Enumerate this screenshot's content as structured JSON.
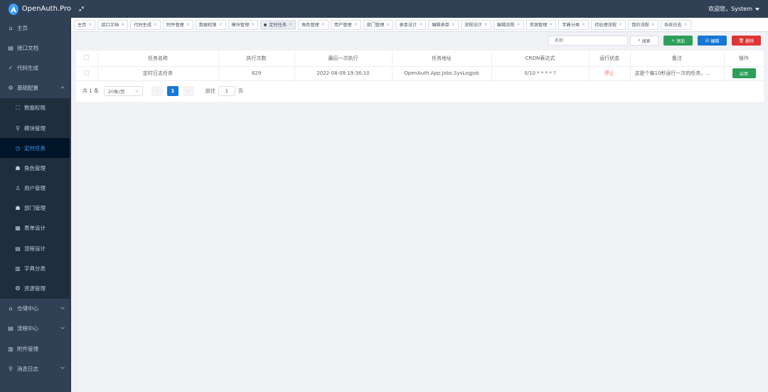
{
  "app": {
    "title": "OpenAuth.Pro"
  },
  "header": {
    "welcome": "欢迎您，System"
  },
  "sidebar": {
    "items": [
      {
        "label": "主页",
        "icon": "home-icon"
      },
      {
        "label": "接口文档",
        "icon": "doc-icon"
      },
      {
        "label": "代码生成",
        "icon": "check-circle-icon"
      },
      {
        "label": "基础配置",
        "icon": "gear-icon",
        "expanded": true
      },
      {
        "label": "数据权限",
        "icon": "data-permission-icon",
        "sub": true
      },
      {
        "label": "模块管理",
        "icon": "tree-icon",
        "sub": true
      },
      {
        "label": "定时任务",
        "icon": "clock-task-icon",
        "sub": true,
        "active": true
      },
      {
        "label": "角色管理",
        "icon": "role-icon",
        "sub": true
      },
      {
        "label": "用户管理",
        "icon": "user-icon",
        "sub": true
      },
      {
        "label": "部门管理",
        "icon": "department-icon",
        "sub": true
      },
      {
        "label": "表单设计",
        "icon": "form-icon",
        "sub": true
      },
      {
        "label": "流程设计",
        "icon": "flow-design-icon",
        "sub": true
      },
      {
        "label": "字典分类",
        "icon": "dictionary-icon",
        "sub": true
      },
      {
        "label": "资源管理",
        "icon": "resource-icon",
        "sub": true
      },
      {
        "label": "仓储中心",
        "icon": "warehouse-icon"
      },
      {
        "label": "流程中心",
        "icon": "flow-center-icon"
      },
      {
        "label": "附件管理",
        "icon": "attachment-icon"
      },
      {
        "label": "消息日志",
        "icon": "message-log-icon"
      }
    ]
  },
  "tabs": [
    {
      "label": "主页"
    },
    {
      "label": "接口文档"
    },
    {
      "label": "代码生成"
    },
    {
      "label": "附件管理"
    },
    {
      "label": "数据权限"
    },
    {
      "label": "模块管理"
    },
    {
      "label": "定时任务",
      "active": true
    },
    {
      "label": "角色管理"
    },
    {
      "label": "用户管理"
    },
    {
      "label": "部门管理"
    },
    {
      "label": "表单设计"
    },
    {
      "label": "编辑表单"
    },
    {
      "label": "流程设计"
    },
    {
      "label": "编辑流程"
    },
    {
      "label": "资源管理"
    },
    {
      "label": "字典分类"
    },
    {
      "label": "待处理流程"
    },
    {
      "label": "我的流程"
    },
    {
      "label": "系统日志"
    }
  ],
  "tab_close": "×",
  "toolbar": {
    "search_placeholder": "名称",
    "search_label": "搜索",
    "add_label": "添加",
    "edit_label": "编辑",
    "delete_label": "删除"
  },
  "table": {
    "columns": [
      "任务名称",
      "执行次数",
      "最后一次执行",
      "任务地址",
      "CRON表达式",
      "运行状态",
      "备注",
      "操作"
    ],
    "rows": [
      {
        "name": "定时日志任务",
        "run_count": "629",
        "last_run": "2022-08-09 19:36:10",
        "address": "OpenAuth.App.Jobs.SysLogJob",
        "cron": "0/10 * * * * ?",
        "status": "停止",
        "note": "这是个每10秒运行一次的任务，...",
        "action": "启用"
      }
    ]
  },
  "pagination": {
    "total_text": "共 1 条",
    "page_size": "20条/页",
    "prev": "‹",
    "current_page": "1",
    "next": "›",
    "goto_prefix": "前往",
    "goto_value": "1",
    "goto_suffix": "页"
  },
  "colors": {
    "sidebar_bg": "#304156",
    "accent": "#409eff",
    "primary_button": "#1777d4",
    "success_button": "#2e9e58",
    "danger_button": "#e03434",
    "stop_status": "#f56c6c"
  }
}
